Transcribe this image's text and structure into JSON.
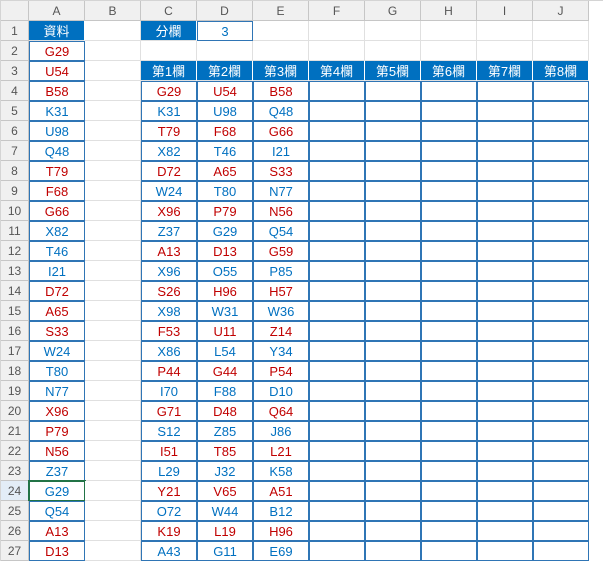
{
  "columns": [
    "A",
    "B",
    "C",
    "D",
    "E",
    "F",
    "G",
    "H",
    "I",
    "J"
  ],
  "rowCount": 27,
  "activeCell": {
    "row": 24,
    "col": 0
  },
  "headerBg": "#0070c0",
  "labels": {
    "A1": "資料",
    "C1": "分欄",
    "D1": "3"
  },
  "tableHeaders": [
    "第1欄",
    "第2欄",
    "第3欄",
    "第4欄",
    "第5欄",
    "第6欄",
    "第7欄",
    "第8欄"
  ],
  "colA": [
    {
      "v": "G29",
      "c": "red"
    },
    {
      "v": "U54",
      "c": "red"
    },
    {
      "v": "B58",
      "c": "red"
    },
    {
      "v": "K31",
      "c": "blue"
    },
    {
      "v": "U98",
      "c": "blue"
    },
    {
      "v": "Q48",
      "c": "blue"
    },
    {
      "v": "T79",
      "c": "red"
    },
    {
      "v": "F68",
      "c": "red"
    },
    {
      "v": "G66",
      "c": "red"
    },
    {
      "v": "X82",
      "c": "blue"
    },
    {
      "v": "T46",
      "c": "blue"
    },
    {
      "v": "I21",
      "c": "blue"
    },
    {
      "v": "D72",
      "c": "red"
    },
    {
      "v": "A65",
      "c": "red"
    },
    {
      "v": "S33",
      "c": "red"
    },
    {
      "v": "W24",
      "c": "blue"
    },
    {
      "v": "T80",
      "c": "blue"
    },
    {
      "v": "N77",
      "c": "blue"
    },
    {
      "v": "X96",
      "c": "red"
    },
    {
      "v": "P79",
      "c": "red"
    },
    {
      "v": "N56",
      "c": "red"
    },
    {
      "v": "Z37",
      "c": "blue"
    },
    {
      "v": "G29",
      "c": "blue"
    },
    {
      "v": "Q54",
      "c": "blue"
    },
    {
      "v": "A13",
      "c": "red"
    },
    {
      "v": "D13",
      "c": "red"
    }
  ],
  "grid": [
    [
      {
        "v": "G29",
        "c": "red"
      },
      {
        "v": "U54",
        "c": "red"
      },
      {
        "v": "B58",
        "c": "red"
      }
    ],
    [
      {
        "v": "K31",
        "c": "blue"
      },
      {
        "v": "U98",
        "c": "blue"
      },
      {
        "v": "Q48",
        "c": "blue"
      }
    ],
    [
      {
        "v": "T79",
        "c": "red"
      },
      {
        "v": "F68",
        "c": "red"
      },
      {
        "v": "G66",
        "c": "red"
      }
    ],
    [
      {
        "v": "X82",
        "c": "blue"
      },
      {
        "v": "T46",
        "c": "blue"
      },
      {
        "v": "I21",
        "c": "blue"
      }
    ],
    [
      {
        "v": "D72",
        "c": "red"
      },
      {
        "v": "A65",
        "c": "red"
      },
      {
        "v": "S33",
        "c": "red"
      }
    ],
    [
      {
        "v": "W24",
        "c": "blue"
      },
      {
        "v": "T80",
        "c": "blue"
      },
      {
        "v": "N77",
        "c": "blue"
      }
    ],
    [
      {
        "v": "X96",
        "c": "red"
      },
      {
        "v": "P79",
        "c": "red"
      },
      {
        "v": "N56",
        "c": "red"
      }
    ],
    [
      {
        "v": "Z37",
        "c": "blue"
      },
      {
        "v": "G29",
        "c": "blue"
      },
      {
        "v": "Q54",
        "c": "blue"
      }
    ],
    [
      {
        "v": "A13",
        "c": "red"
      },
      {
        "v": "D13",
        "c": "red"
      },
      {
        "v": "G59",
        "c": "red"
      }
    ],
    [
      {
        "v": "X96",
        "c": "blue"
      },
      {
        "v": "O55",
        "c": "blue"
      },
      {
        "v": "P85",
        "c": "blue"
      }
    ],
    [
      {
        "v": "S26",
        "c": "red"
      },
      {
        "v": "H96",
        "c": "red"
      },
      {
        "v": "H57",
        "c": "red"
      }
    ],
    [
      {
        "v": "X98",
        "c": "blue"
      },
      {
        "v": "W31",
        "c": "blue"
      },
      {
        "v": "W36",
        "c": "blue"
      }
    ],
    [
      {
        "v": "F53",
        "c": "red"
      },
      {
        "v": "U11",
        "c": "red"
      },
      {
        "v": "Z14",
        "c": "red"
      }
    ],
    [
      {
        "v": "X86",
        "c": "blue"
      },
      {
        "v": "L54",
        "c": "blue"
      },
      {
        "v": "Y34",
        "c": "blue"
      }
    ],
    [
      {
        "v": "P44",
        "c": "red"
      },
      {
        "v": "G44",
        "c": "red"
      },
      {
        "v": "P54",
        "c": "red"
      }
    ],
    [
      {
        "v": "I70",
        "c": "blue"
      },
      {
        "v": "F88",
        "c": "blue"
      },
      {
        "v": "D10",
        "c": "blue"
      }
    ],
    [
      {
        "v": "G71",
        "c": "red"
      },
      {
        "v": "D48",
        "c": "red"
      },
      {
        "v": "Q64",
        "c": "red"
      }
    ],
    [
      {
        "v": "S12",
        "c": "blue"
      },
      {
        "v": "Z85",
        "c": "blue"
      },
      {
        "v": "J86",
        "c": "blue"
      }
    ],
    [
      {
        "v": "I51",
        "c": "red"
      },
      {
        "v": "T85",
        "c": "red"
      },
      {
        "v": "L21",
        "c": "red"
      }
    ],
    [
      {
        "v": "L29",
        "c": "blue"
      },
      {
        "v": "J32",
        "c": "blue"
      },
      {
        "v": "K58",
        "c": "blue"
      }
    ],
    [
      {
        "v": "Y21",
        "c": "red"
      },
      {
        "v": "V65",
        "c": "red"
      },
      {
        "v": "A51",
        "c": "red"
      }
    ],
    [
      {
        "v": "O72",
        "c": "blue"
      },
      {
        "v": "W44",
        "c": "blue"
      },
      {
        "v": "B12",
        "c": "blue"
      }
    ],
    [
      {
        "v": "K19",
        "c": "red"
      },
      {
        "v": "L19",
        "c": "red"
      },
      {
        "v": "H96",
        "c": "red"
      }
    ],
    [
      {
        "v": "A43",
        "c": "blue"
      },
      {
        "v": "G11",
        "c": "blue"
      },
      {
        "v": "E69",
        "c": "blue"
      }
    ]
  ]
}
